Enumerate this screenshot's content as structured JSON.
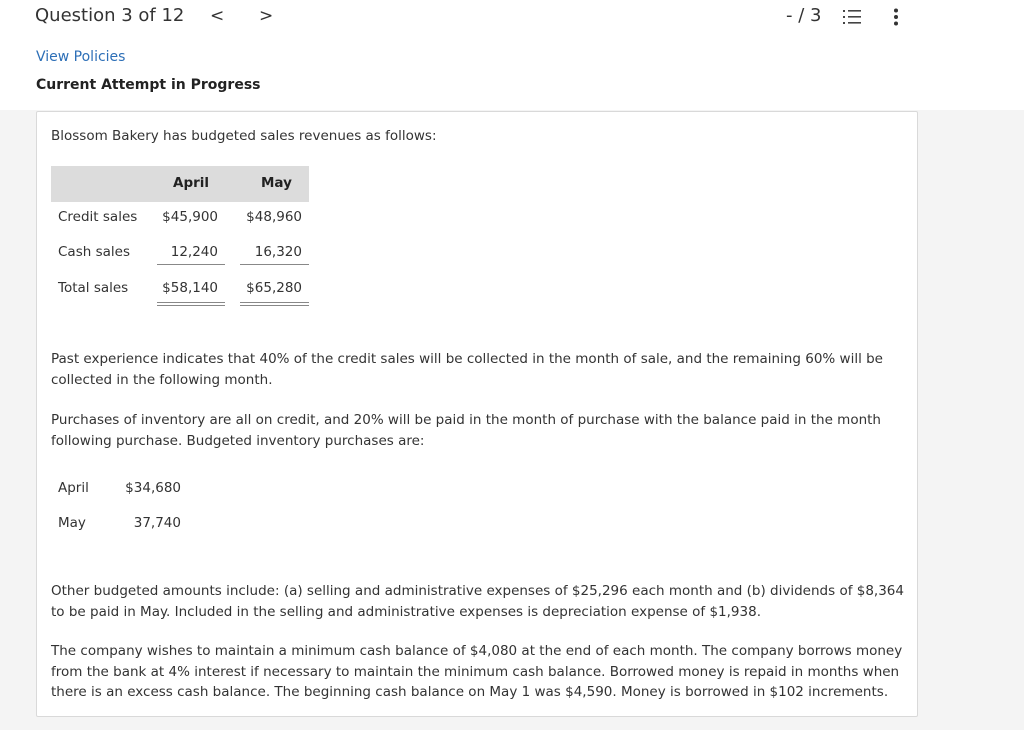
{
  "header": {
    "question_label": "Question 3 of 12",
    "prev_glyph": "<",
    "next_glyph": ">",
    "score": "- / 3"
  },
  "policies": {
    "link": "View Policies",
    "status": "Current Attempt in Progress"
  },
  "problem": {
    "intro": "Blossom Bakery has budgeted sales revenues as follows:",
    "sales_table": {
      "columns": [
        "April",
        "May"
      ],
      "rows": [
        {
          "label": "Credit sales",
          "april": "$45,900",
          "may": "$48,960"
        },
        {
          "label": "Cash sales",
          "april": "12,240",
          "may": "16,320"
        },
        {
          "label": "Total sales",
          "april": "$58,140",
          "may": "$65,280"
        }
      ]
    },
    "para_collections": "Past experience indicates that 40% of the credit sales will be collected in the month of sale, and the remaining 60% will be collected in the following month.",
    "para_purchases": "Purchases of inventory are all on credit, and 20% will be paid in the month of purchase with the balance paid in the month following purchase. Budgeted inventory purchases are:",
    "purchases_table": [
      {
        "month": "April",
        "amount": "$34,680"
      },
      {
        "month": "May",
        "amount": "37,740"
      }
    ],
    "para_other": "Other budgeted amounts include: (a) selling and administrative expenses of $25,296 each month and (b) dividends of $8,364 to be paid in May. Included in the selling and administrative expenses is depreciation expense of $1,938.",
    "para_cash": "The company wishes to maintain a minimum cash balance of $4,080 at the end of each month. The company borrows money from the bank at 4% interest if necessary to maintain the minimum cash balance. Borrowed money is repaid in months when there is an excess cash balance. The beginning cash balance on May 1 was $4,590. Money is borrowed in $102 increments."
  },
  "icons": {
    "prev": "chevron-left-icon",
    "next": "chevron-right-icon",
    "question_list": "list-icon",
    "more": "more-vertical-icon"
  },
  "colors": {
    "link": "#2d6fb7",
    "table_header": "#dcdcdc"
  }
}
